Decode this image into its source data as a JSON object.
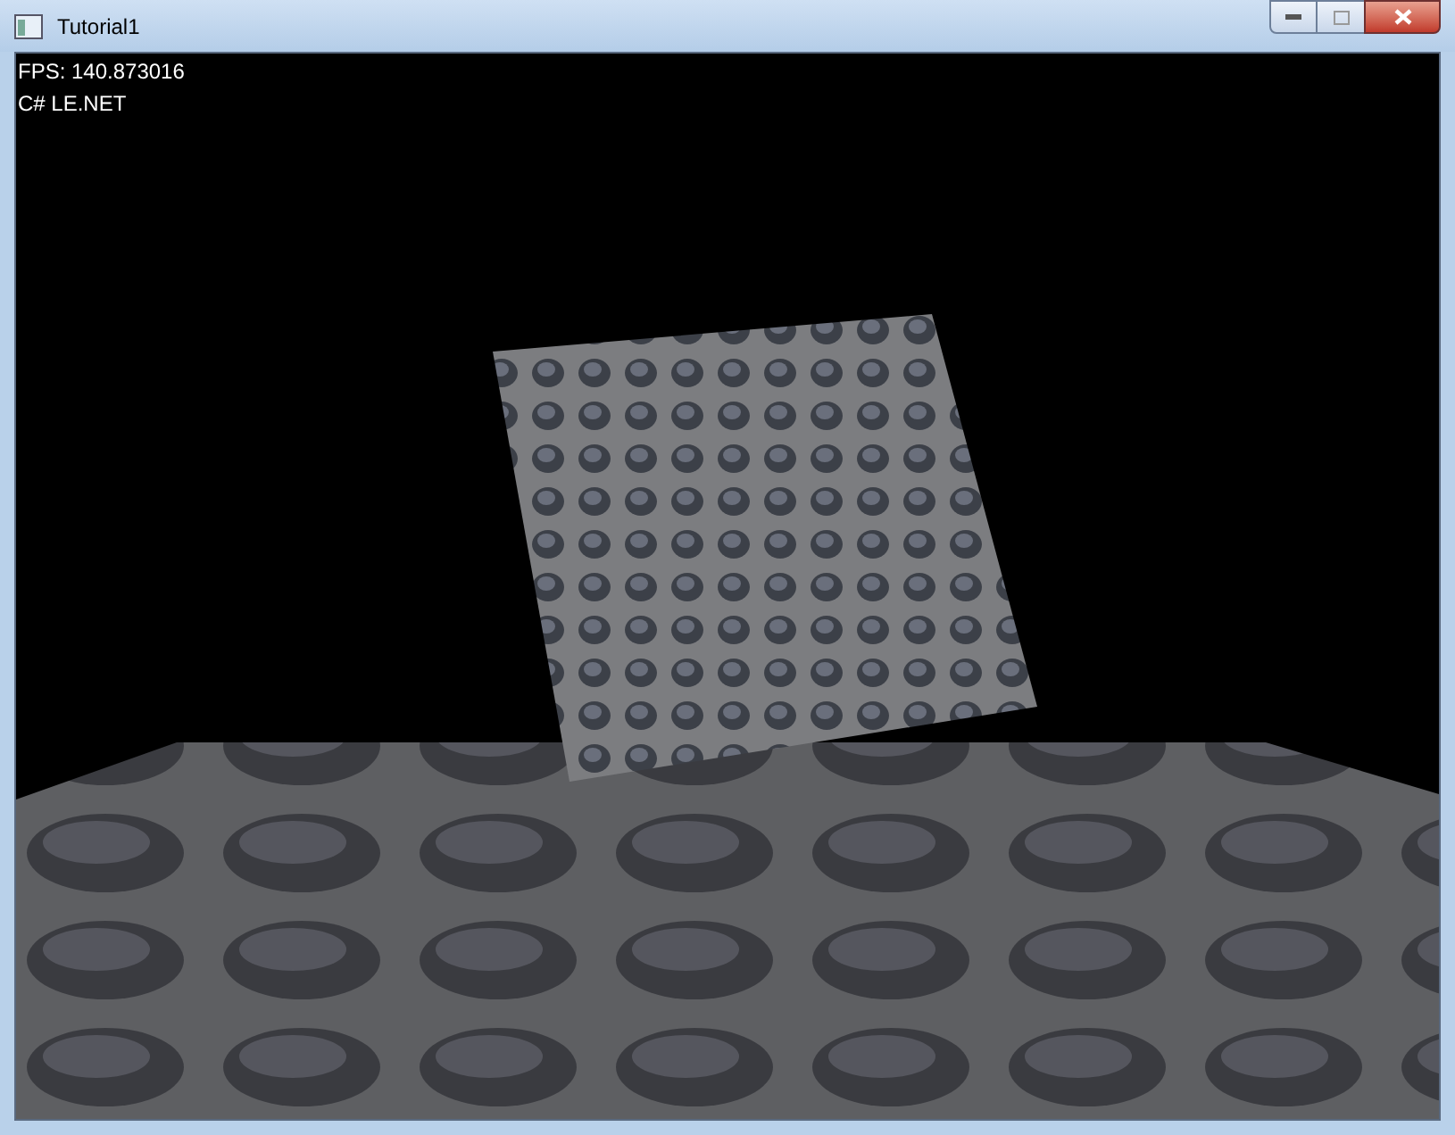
{
  "window": {
    "title": "Tutorial1"
  },
  "overlay": {
    "lines": [
      "FPS: 140.873016",
      "C# LE.NET"
    ]
  }
}
